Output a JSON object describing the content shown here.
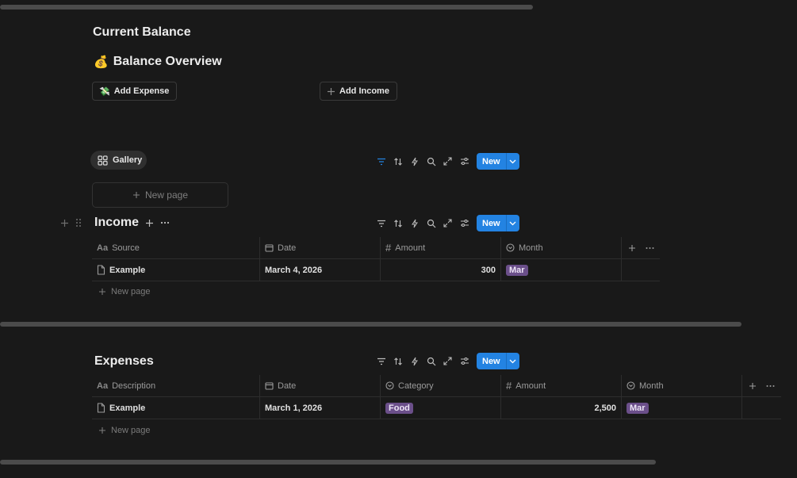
{
  "header": {
    "current_balance": "Current Balance",
    "overview_emoji": "💰",
    "overview_title": "Balance Overview"
  },
  "actions": {
    "add_expense_emoji": "💸",
    "add_expense": "Add Expense",
    "add_income": "Add Income"
  },
  "gallery": {
    "view_label": "Gallery",
    "new_page": "New page"
  },
  "toolbar": {
    "new_label": "New"
  },
  "income": {
    "title": "Income",
    "columns": [
      "Source",
      "Date",
      "Amount",
      "Month"
    ],
    "rows": [
      {
        "source": "Example",
        "date": "March 4, 2026",
        "amount": "300",
        "month": "Mar"
      }
    ],
    "new_page": "New page"
  },
  "expenses": {
    "title": "Expenses",
    "columns": [
      "Description",
      "Date",
      "Category",
      "Amount",
      "Month"
    ],
    "rows": [
      {
        "description": "Example",
        "date": "March 1, 2026",
        "category": "Food",
        "amount": "2,500",
        "month": "Mar"
      }
    ],
    "new_page": "New page"
  },
  "colors": {
    "accent": "#2383e2",
    "tag_purple": "#6b4f8a",
    "background": "#191919"
  }
}
